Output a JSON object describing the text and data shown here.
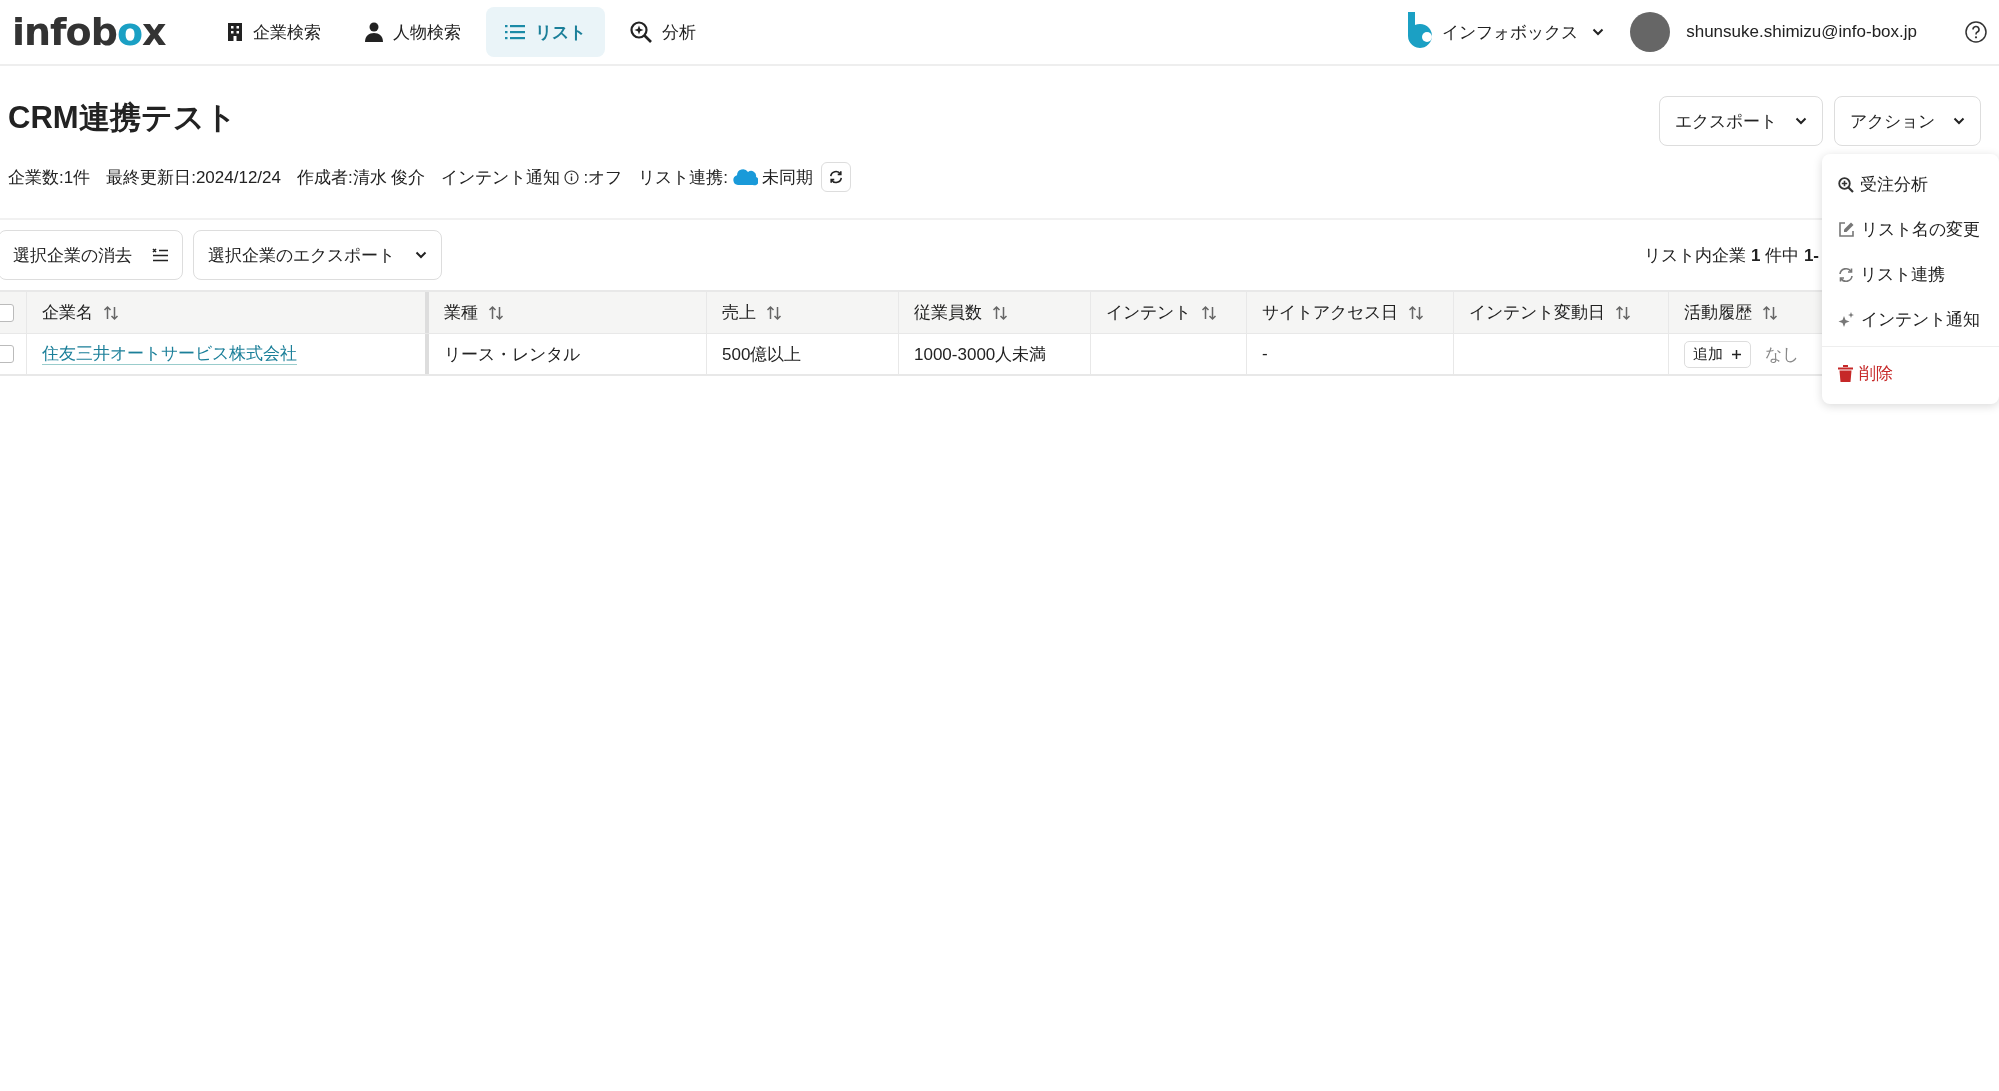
{
  "nav": {
    "logo": "infobox",
    "items": [
      {
        "label": "企業検索",
        "selected": false
      },
      {
        "label": "人物検索",
        "selected": false
      },
      {
        "label": "リスト",
        "selected": true
      },
      {
        "label": "分析",
        "selected": false
      }
    ],
    "workspace": "インフォボックス",
    "user_email": "shunsuke.shimizu@info-box.jp"
  },
  "page": {
    "title": "CRM連携テスト",
    "meta": [
      {
        "kind": "text",
        "text": "企業数:1件"
      },
      {
        "kind": "text",
        "text": "最終更新日:2024/12/24"
      },
      {
        "kind": "text",
        "text": "作成者:清水 俊介"
      },
      {
        "kind": "info",
        "label": "インテント通知",
        "value": ":オフ"
      },
      {
        "kind": "sync",
        "label": "リスト連携:",
        "status": "未同期"
      }
    ],
    "header_buttons": [
      "エクスポート",
      "アクション"
    ]
  },
  "toolbar": {
    "buttons": [
      {
        "label": "選択企業の消去",
        "kind": "clear"
      },
      {
        "label": "選択企業のエクスポート",
        "kind": "dropdown"
      }
    ],
    "count_text": "リスト内企業 **1** 件中 **1-**"
  },
  "table": {
    "select_all_checked": false,
    "columns": [
      "企業名",
      "業種",
      "売上",
      "従業員数",
      "インテント",
      "サイトアクセス日",
      "インテント変動日",
      "活動履歴"
    ],
    "rows": [
      {
        "checked": false,
        "cells": [
          {
            "kind": "link",
            "text": "住友三井オートサービス株式会社"
          },
          {
            "kind": "text",
            "text": "リース・レンタル"
          },
          {
            "kind": "text",
            "text": "500億以上"
          },
          {
            "kind": "text",
            "text": "1000-3000人未満"
          },
          {
            "kind": "empty"
          },
          {
            "kind": "text",
            "text": "-"
          },
          {
            "kind": "empty"
          },
          {
            "kind": "activity",
            "button": "追加",
            "text": "なし"
          }
        ]
      }
    ]
  },
  "action_menu": {
    "items": [
      {
        "label": "受注分析",
        "kind": "normal"
      },
      {
        "label": "リスト名の変更",
        "kind": "normal"
      },
      {
        "label": "リスト連携",
        "kind": "normal"
      },
      {
        "label": "インテント通知",
        "kind": "normal"
      },
      {
        "label": "削除",
        "kind": "danger"
      }
    ]
  }
}
